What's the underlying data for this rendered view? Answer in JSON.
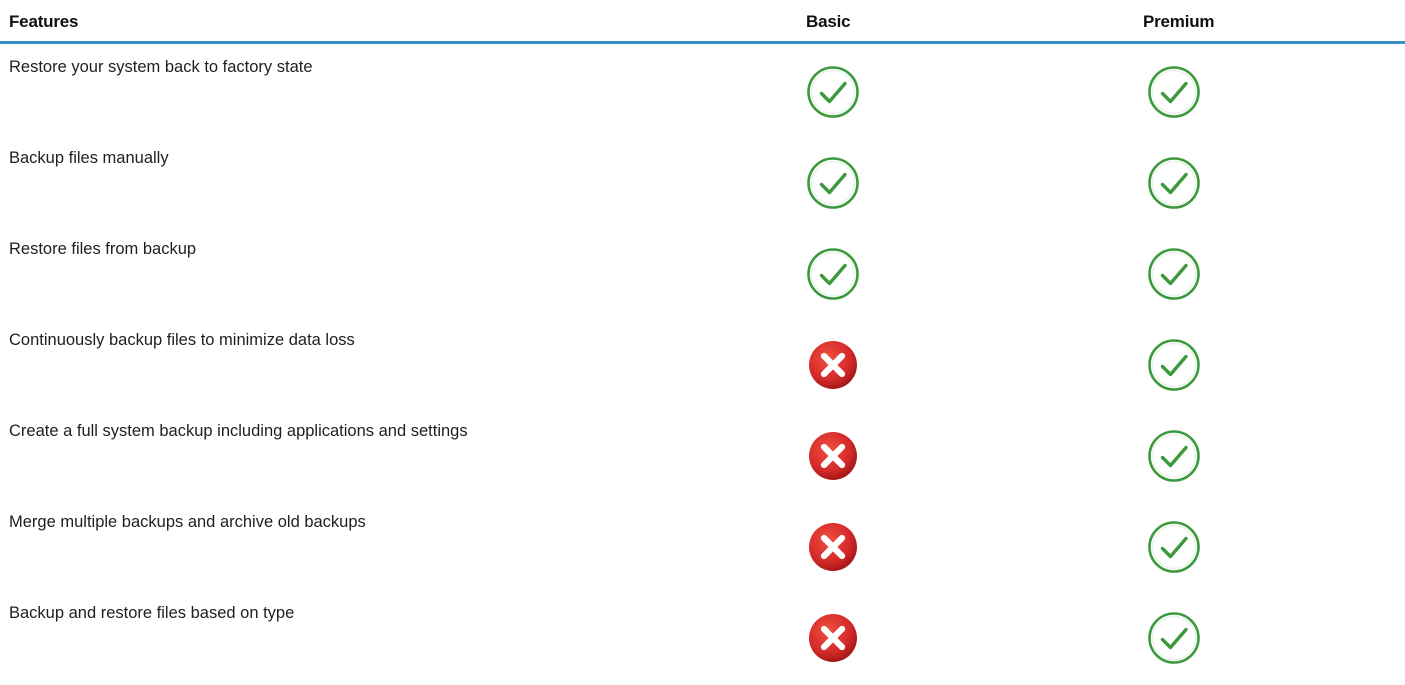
{
  "table": {
    "headers": {
      "features": "Features",
      "basic": "Basic",
      "premium": "Premium"
    },
    "rows": [
      {
        "feature": "Restore your system back to factory state",
        "basic": "check",
        "premium": "check"
      },
      {
        "feature": "Backup files manually",
        "basic": "check",
        "premium": "check"
      },
      {
        "feature": "Restore files from backup",
        "basic": "check",
        "premium": "check"
      },
      {
        "feature": "Continuously backup files to minimize data loss",
        "basic": "cross",
        "premium": "check"
      },
      {
        "feature": "Create a full system backup including applications and settings",
        "basic": "cross",
        "premium": "check"
      },
      {
        "feature": "Merge multiple backups and archive old backups",
        "basic": "cross",
        "premium": "check"
      },
      {
        "feature": "Backup and restore files based on type",
        "basic": "cross",
        "premium": "check"
      }
    ]
  },
  "colors": {
    "header_rule": "#3a8fca",
    "check_green": "#3c9a3c",
    "cross_red": "#d42a2a"
  },
  "icons": {
    "check": "check-circle-icon",
    "cross": "x-circle-icon"
  }
}
